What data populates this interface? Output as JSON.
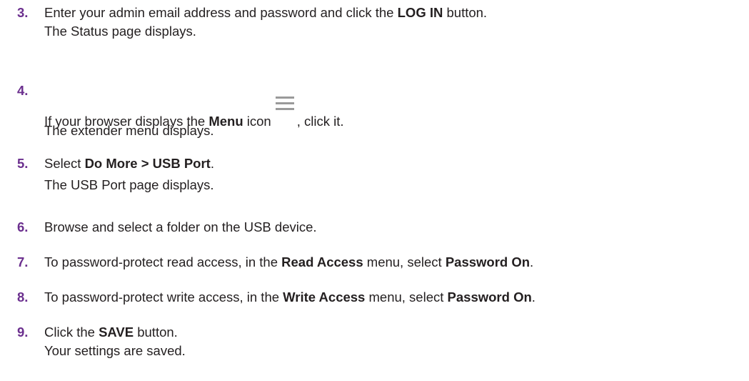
{
  "steps": [
    {
      "number": "3.",
      "lines": [
        [
          "Enter your admin email address and password and click the ",
          "LOG IN",
          " button."
        ],
        [
          "The Status page displays."
        ]
      ]
    },
    {
      "number": "4.",
      "lines": [
        [
          "If your browser displays the ",
          "Menu",
          " icon",
          ", click it."
        ],
        [
          "The extender menu displays."
        ]
      ],
      "icon": "hamburger-menu-icon"
    },
    {
      "number": "5.",
      "lines": [
        [
          "Select ",
          "Do More > USB Port",
          "."
        ],
        [
          "The USB Port page displays."
        ]
      ]
    },
    {
      "number": "6.",
      "lines": [
        [
          "Browse and select a folder on the USB device."
        ]
      ]
    },
    {
      "number": "7.",
      "lines": [
        [
          "To password-protect read access, in the ",
          "Read Access",
          " menu, select ",
          "Password On",
          "."
        ]
      ]
    },
    {
      "number": "8.",
      "lines": [
        [
          "To password-protect write access, in the ",
          "Write Access",
          " menu, select ",
          "Password On",
          "."
        ]
      ]
    },
    {
      "number": "9.",
      "lines": [
        [
          "Click the ",
          "SAVE",
          " button."
        ],
        [
          "Your settings are saved."
        ]
      ]
    }
  ],
  "colors": {
    "step_number": "#6b2f8e",
    "text": "#231f20",
    "icon": "#9a9a9a"
  }
}
